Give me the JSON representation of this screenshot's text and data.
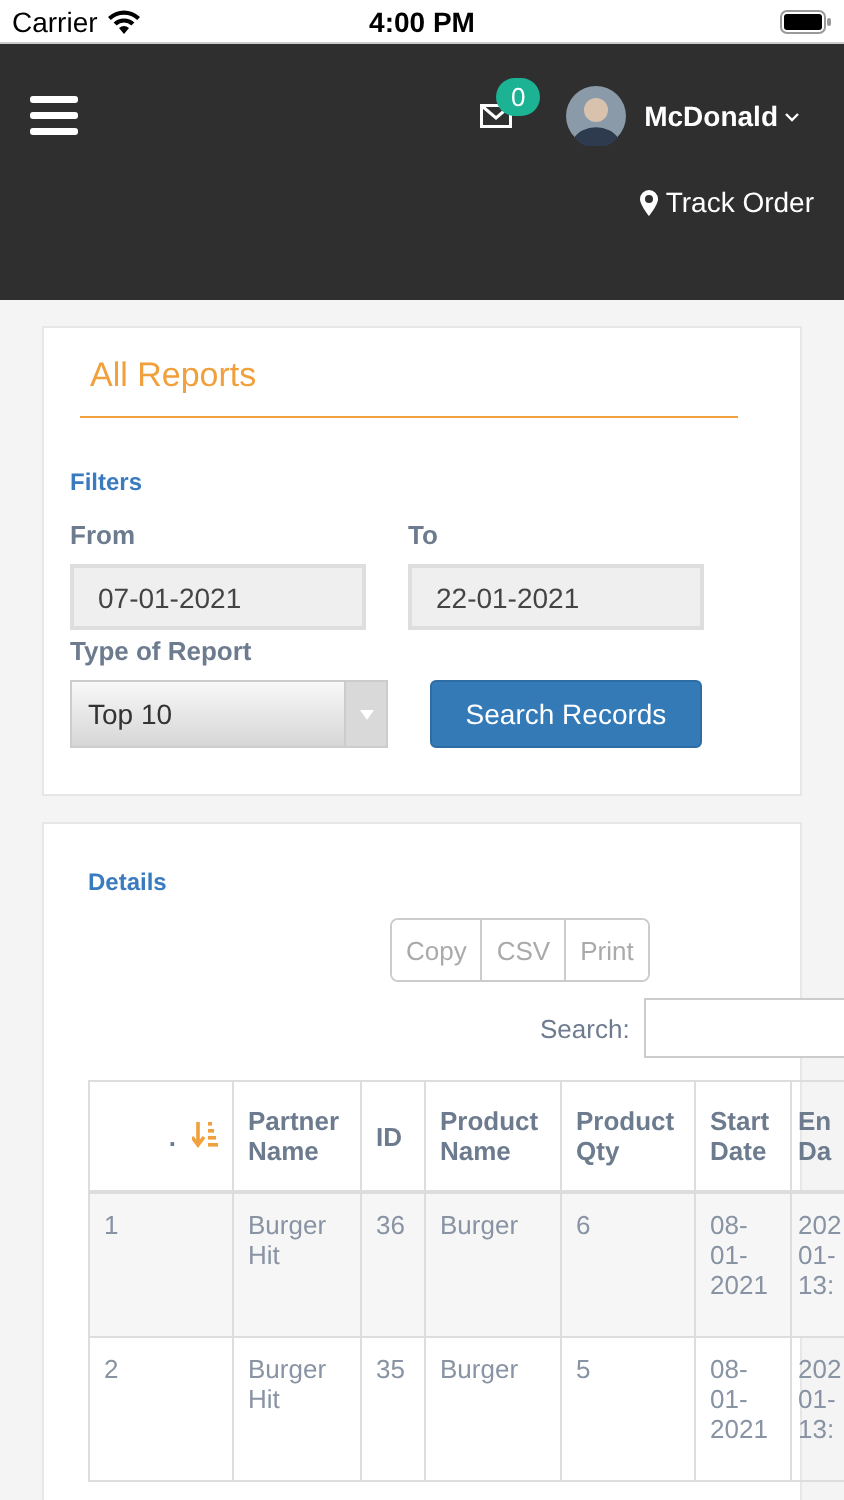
{
  "status_bar": {
    "carrier": "Carrier",
    "time": "4:00 PM"
  },
  "header": {
    "notifications": "0",
    "user": "McDonald",
    "track_order": "Track Order"
  },
  "reports": {
    "title": "All Reports",
    "filters_label": "Filters",
    "from": {
      "label": "From",
      "value": "07-01-2021"
    },
    "to": {
      "label": "To",
      "value": "22-01-2021"
    },
    "report_type": {
      "label": "Type of Report",
      "value": "Top 10"
    },
    "search_button": "Search Records"
  },
  "details": {
    "title": "Details",
    "export_buttons": [
      "Copy",
      "CSV",
      "Print"
    ],
    "search_label": "Search:",
    "table": {
      "columns": [
        {
          "label": ".",
          "sorted": true
        },
        {
          "label": "Partner Name",
          "sorted": false
        },
        {
          "label": "ID",
          "sorted": false
        },
        {
          "label": "Product Name",
          "sorted": false
        },
        {
          "label": "Product Qty",
          "sorted": false
        },
        {
          "label": "Start Date",
          "sorted": false
        },
        {
          "label": "En Da",
          "sorted": false
        }
      ],
      "rows": [
        [
          "1",
          "Burger Hit",
          "36",
          "Burger",
          "6",
          "08-01-2021",
          "202 01- 13:"
        ],
        [
          "2",
          "Burger Hit",
          "35",
          "Burger",
          "5",
          "08-01-2021",
          "202 01- 13:"
        ]
      ]
    }
  }
}
